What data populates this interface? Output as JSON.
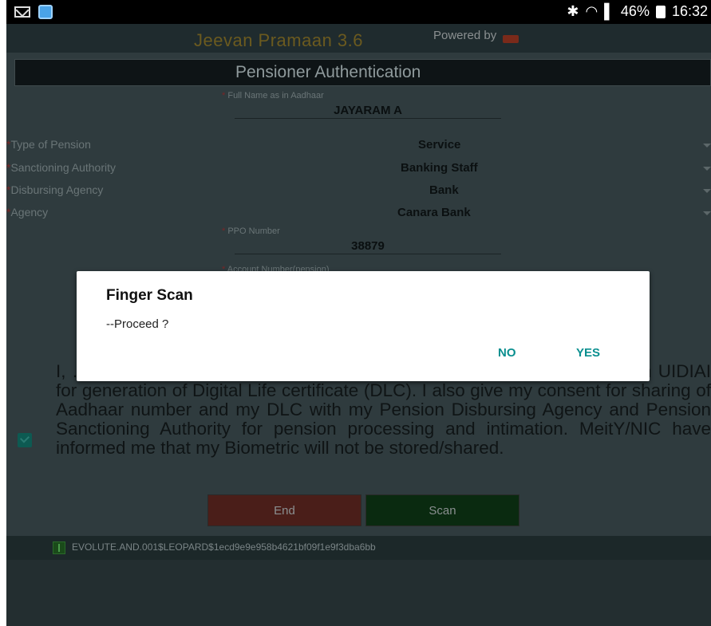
{
  "status_bar": {
    "icons": [
      "mail-icon",
      "app-icon",
      "bluetooth-icon",
      "wifi-icon",
      "signal-icon",
      "battery-icon"
    ],
    "battery": "46%",
    "time": "16:32"
  },
  "app": {
    "title": "Jeevan Pramaan 3.6",
    "powered_by": "Powered by",
    "header": "Pensioner Authentication"
  },
  "form": {
    "full_name": {
      "label": "Full Name as in Aadhaar",
      "value": "JAYARAM A"
    },
    "type_of_pension": {
      "label": "Type of Pension",
      "value": "Service"
    },
    "sanctioning_authority": {
      "label": "Sanctioning Authority",
      "value": "Banking Staff"
    },
    "disbursing_agency": {
      "label": "Disbursing Agency",
      "value": "Bank"
    },
    "agency": {
      "label": "Agency",
      "value": "Canara Bank"
    },
    "ppo_number": {
      "label": "PPO Number",
      "value": "38879"
    },
    "account_number": {
      "label": "Account Number(pension)"
    }
  },
  "consent": {
    "checked": true,
    "text": "I, ... nt to MeitY to use my Aadhaar number, biometric etc for e-KYC with UIDIAI for generation of Digital Life certificate (DLC). I also give my consent for sharing of Aadhaar number and my DLC with my Pension Disbursing Agency and Pension Sanctioning Authority for pension processing and intimation. MeitY/NIC have informed me that my Biometric will not be stored/shared."
  },
  "buttons": {
    "end": "End",
    "scan": "Scan"
  },
  "device": {
    "id": "EVOLUTE.AND.001$LEOPARD$1ecd9e9e958b4621bf09f1e9f3dba6bb"
  },
  "dialog": {
    "title": "Finger Scan",
    "message": "--Proceed ?",
    "no": "NO",
    "yes": "YES"
  },
  "colors": {
    "dialog_accent": "#0a8f8f",
    "end_button": "#4a1e19",
    "scan_button": "#0a2a10"
  }
}
